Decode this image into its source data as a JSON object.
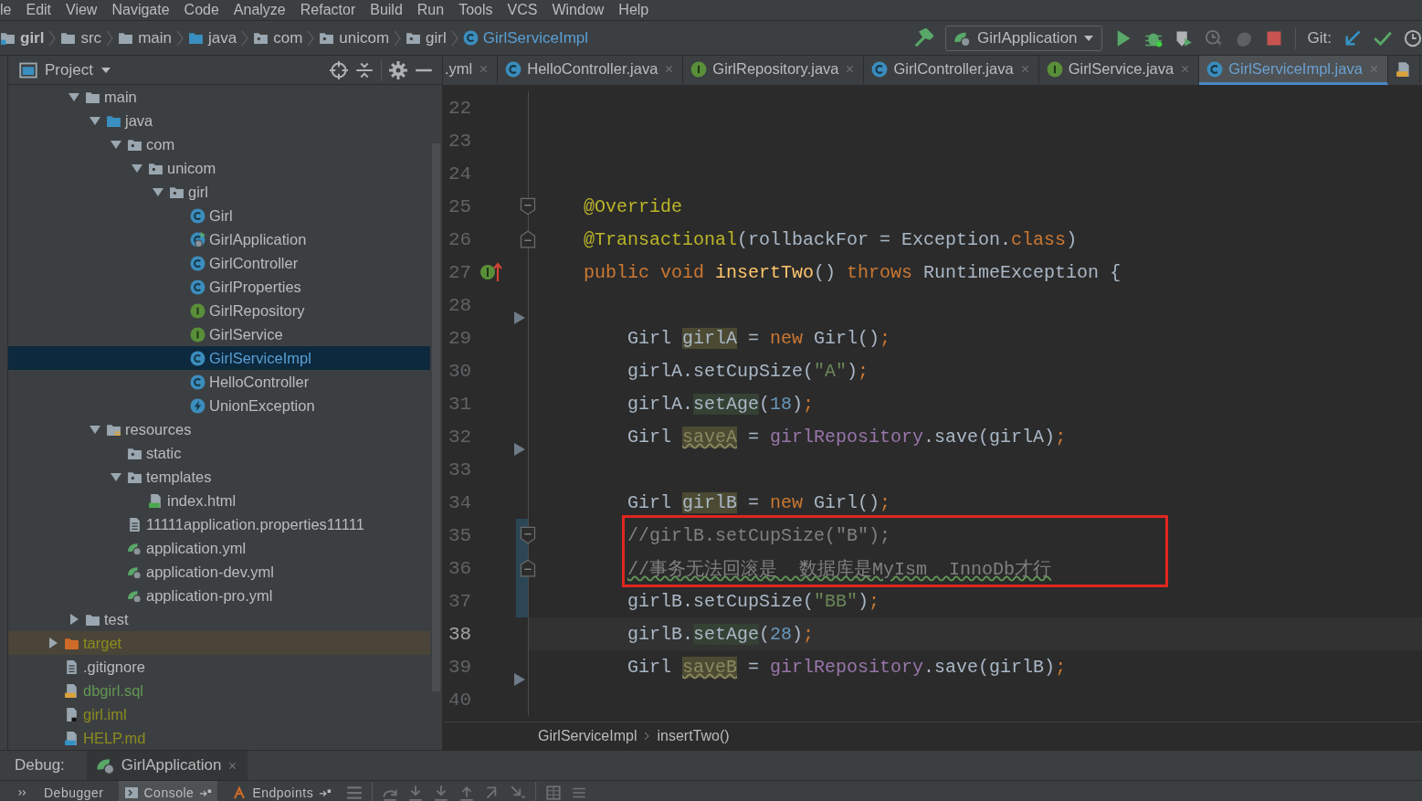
{
  "menu": [
    "le",
    "Edit",
    "View",
    "Navigate",
    "Code",
    "Analyze",
    "Refactor",
    "Build",
    "Run",
    "Tools",
    "VCS",
    "Window",
    "Help"
  ],
  "breadcrumbs": [
    {
      "label": "girl",
      "kind": "module"
    },
    {
      "label": "src",
      "kind": "folder"
    },
    {
      "label": "main",
      "kind": "folder"
    },
    {
      "label": "java",
      "kind": "source-folder"
    },
    {
      "label": "com",
      "kind": "package"
    },
    {
      "label": "unicom",
      "kind": "package"
    },
    {
      "label": "girl",
      "kind": "package"
    },
    {
      "label": "GirlServiceImpl",
      "kind": "class"
    }
  ],
  "run_config": "GirlApplication",
  "vcs_label": "Git:",
  "project_panel": {
    "title": "Project"
  },
  "tree": [
    {
      "children": [
        {
          "label": "main",
          "kind": "folder",
          "expanded": true,
          "selected": false,
          "children": [
            {
              "label": "java",
              "kind": "source-folder",
              "expanded": true,
              "selected": false,
              "children": [
                {
                  "label": "com",
                  "kind": "package",
                  "expanded": true,
                  "selected": false,
                  "children": [
                    {
                      "label": "unicom",
                      "kind": "package",
                      "expanded": true,
                      "selected": false,
                      "children": [
                        {
                          "label": "girl",
                          "kind": "package",
                          "expanded": true,
                          "selected": false,
                          "children": [
                            {
                              "label": "Girl",
                              "kind": "class",
                              "selected": false
                            },
                            {
                              "label": "GirlApplication",
                              "kind": "spring-class",
                              "selected": false
                            },
                            {
                              "label": "GirlController",
                              "kind": "class",
                              "selected": false
                            },
                            {
                              "label": "GirlProperties",
                              "kind": "class",
                              "selected": false
                            },
                            {
                              "label": "GirlRepository",
                              "kind": "interface",
                              "selected": false
                            },
                            {
                              "label": "GirlService",
                              "kind": "interface",
                              "selected": false
                            },
                            {
                              "label": "GirlServiceImpl",
                              "kind": "class",
                              "selected": true
                            },
                            {
                              "label": "HelloController",
                              "kind": "class",
                              "selected": false
                            },
                            {
                              "label": "UnionException",
                              "kind": "exception",
                              "selected": false
                            }
                          ]
                        }
                      ]
                    }
                  ]
                }
              ]
            },
            {
              "label": "resources",
              "kind": "resources",
              "expanded": true,
              "selected": false,
              "children": [
                {
                  "label": "static",
                  "kind": "package",
                  "selected": false
                },
                {
                  "label": "templates",
                  "kind": "package",
                  "expanded": true,
                  "selected": false,
                  "children": [
                    {
                      "label": "index.html",
                      "kind": "html",
                      "selected": false
                    }
                  ]
                },
                {
                  "label": "11111application.properties11111",
                  "kind": "text",
                  "selected": false
                },
                {
                  "label": "application.yml",
                  "kind": "yml",
                  "selected": false
                },
                {
                  "label": "application-dev.yml",
                  "kind": "yml",
                  "selected": false
                },
                {
                  "label": "application-pro.yml",
                  "kind": "yml",
                  "selected": false
                }
              ]
            }
          ]
        },
        {
          "label": "test",
          "kind": "folder",
          "expanded": false,
          "selected": false
        }
      ]
    },
    {
      "label": "target",
      "kind": "excluded-folder",
      "expanded": false,
      "selected": false,
      "color": "#8c8c1e"
    },
    {
      "label": ".gitignore",
      "kind": "text",
      "selected": false
    },
    {
      "label": "dbgirl.sql",
      "kind": "sql",
      "selected": false,
      "color": "#629755"
    },
    {
      "label": "girl.iml",
      "kind": "iml",
      "selected": false,
      "color": "#8c8c1e"
    },
    {
      "label": "HELP.md",
      "kind": "md",
      "selected": false,
      "color": "#8c8c1e"
    }
  ],
  "tabs": [
    {
      "label": ".yml",
      "kind": "plain",
      "selected": false
    },
    {
      "label": "HelloController.java",
      "kind": "class",
      "selected": false
    },
    {
      "label": "GirlRepository.java",
      "kind": "interface",
      "selected": false
    },
    {
      "label": "GirlController.java",
      "kind": "class",
      "selected": false
    },
    {
      "label": "GirlService.java",
      "kind": "interface",
      "selected": false
    },
    {
      "label": "GirlServiceImpl.java",
      "kind": "class",
      "selected": true
    },
    {
      "kind": "sql",
      "selected": false
    }
  ],
  "editor": {
    "lines": [
      {
        "number": "22",
        "kind": "plain",
        "changed": false,
        "current": false,
        "boxed": false
      },
      {
        "number": "23",
        "kind": "plain",
        "changed": false,
        "current": false,
        "boxed": false
      },
      {
        "number": "24",
        "kind": "plain",
        "changed": false,
        "current": false,
        "boxed": false
      },
      {
        "number": "25",
        "kind": "fold-start",
        "changed": false,
        "current": false,
        "boxed": false,
        "tokens": [
          {
            "text": "    @Override",
            "kind": "annotation"
          }
        ]
      },
      {
        "number": "26",
        "kind": "fold-end",
        "changed": false,
        "current": false,
        "boxed": false,
        "tokens": [
          {
            "text": "    @Transactional",
            "kind": "annotation"
          },
          {
            "text": "(rollbackFor = Exception.",
            "kind": "plain"
          },
          {
            "text": "class",
            "kind": "keyword"
          },
          {
            "text": ")",
            "kind": "plain"
          }
        ]
      },
      {
        "number": "27",
        "kind": "implements",
        "changed": false,
        "current": false,
        "boxed": false,
        "tokens": [
          {
            "text": "    public void ",
            "kind": "keyword"
          },
          {
            "text": "insertTwo",
            "kind": "method"
          },
          {
            "text": "() ",
            "kind": "plain"
          },
          {
            "text": "throws ",
            "kind": "keyword"
          },
          {
            "text": "RuntimeException {",
            "kind": "plain"
          }
        ]
      },
      {
        "number": "28",
        "kind": "marker",
        "changed": false,
        "current": false,
        "boxed": false
      },
      {
        "number": "29",
        "kind": "plain",
        "changed": false,
        "current": false,
        "boxed": false,
        "tokens": [
          {
            "text": "        Girl ",
            "kind": "plain"
          },
          {
            "text": "girlA",
            "kind": "var"
          },
          {
            "text": " = ",
            "kind": "plain"
          },
          {
            "text": "new ",
            "kind": "keyword"
          },
          {
            "text": "Girl()",
            "kind": "plain"
          },
          {
            "text": ";",
            "kind": "keyword"
          }
        ]
      },
      {
        "number": "30",
        "kind": "plain",
        "changed": false,
        "current": false,
        "boxed": false,
        "tokens": [
          {
            "text": "        girlA.setCupSize(",
            "kind": "plain"
          },
          {
            "text": "\"A\"",
            "kind": "string"
          },
          {
            "text": ")",
            "kind": "plain"
          },
          {
            "text": ";",
            "kind": "keyword"
          }
        ]
      },
      {
        "number": "31",
        "kind": "plain",
        "changed": false,
        "current": false,
        "boxed": false,
        "tokens": [
          {
            "text": "        girlA.",
            "kind": "plain"
          },
          {
            "text": "setAge",
            "kind": "call"
          },
          {
            "text": "(",
            "kind": "plain"
          },
          {
            "text": "18",
            "kind": "number"
          },
          {
            "text": ")",
            "kind": "plain"
          },
          {
            "text": ";",
            "kind": "keyword"
          }
        ]
      },
      {
        "number": "32",
        "kind": "marker",
        "changed": false,
        "current": false,
        "boxed": false,
        "tokens": [
          {
            "text": "        Girl ",
            "kind": "plain"
          },
          {
            "text": "saveA",
            "kind": "unused"
          },
          {
            "text": " = ",
            "kind": "plain"
          },
          {
            "text": "girlRepository",
            "kind": "field"
          },
          {
            "text": ".save(girlA)",
            "kind": "plain"
          },
          {
            "text": ";",
            "kind": "keyword"
          }
        ]
      },
      {
        "number": "33",
        "kind": "plain",
        "changed": false,
        "current": false,
        "boxed": false
      },
      {
        "number": "34",
        "kind": "plain",
        "changed": false,
        "current": false,
        "boxed": false,
        "tokens": [
          {
            "text": "        Girl ",
            "kind": "plain"
          },
          {
            "text": "girlB",
            "kind": "var"
          },
          {
            "text": " = ",
            "kind": "plain"
          },
          {
            "text": "new ",
            "kind": "keyword"
          },
          {
            "text": "Girl()",
            "kind": "plain"
          },
          {
            "text": ";",
            "kind": "keyword"
          }
        ]
      },
      {
        "number": "35",
        "kind": "fold-start",
        "changed": true,
        "current": false,
        "boxed": true,
        "tokens": [
          {
            "text": "        //girlB.setCupSize(\"B\");",
            "kind": "comment"
          }
        ]
      },
      {
        "number": "36",
        "kind": "fold-end",
        "changed": true,
        "current": false,
        "boxed": true,
        "tokens": [
          {
            "text": "        //事务无法回滚是  数据库是MyIsm  InnoDb才行",
            "kind": "typo"
          }
        ]
      },
      {
        "number": "37",
        "kind": "plain",
        "changed": true,
        "current": false,
        "boxed": false,
        "tokens": [
          {
            "text": "        girlB.setCupSize(",
            "kind": "plain"
          },
          {
            "text": "\"BB\"",
            "kind": "string"
          },
          {
            "text": ")",
            "kind": "plain"
          },
          {
            "text": ";",
            "kind": "keyword"
          }
        ]
      },
      {
        "number": "38",
        "kind": "plain",
        "changed": false,
        "current": true,
        "boxed": false,
        "tokens": [
          {
            "text": "        girlB.",
            "kind": "plain"
          },
          {
            "text": "setAge",
            "kind": "call"
          },
          {
            "text": "(",
            "kind": "plain"
          },
          {
            "text": "28",
            "kind": "number"
          },
          {
            "text": ")",
            "kind": "plain"
          },
          {
            "text": ";",
            "kind": "keyword"
          }
        ]
      },
      {
        "number": "39",
        "kind": "marker",
        "changed": false,
        "current": false,
        "boxed": false,
        "tokens": [
          {
            "text": "        Girl ",
            "kind": "plain"
          },
          {
            "text": "saveB",
            "kind": "unused"
          },
          {
            "text": " = ",
            "kind": "plain"
          },
          {
            "text": "girlRepository",
            "kind": "field"
          },
          {
            "text": ".save(girlB)",
            "kind": "plain"
          },
          {
            "text": ";",
            "kind": "keyword"
          }
        ]
      },
      {
        "number": "40",
        "kind": "plain",
        "changed": false,
        "current": false,
        "boxed": false
      }
    ],
    "breadcrumbs": [
      "GirlServiceImpl",
      "insertTwo()"
    ]
  },
  "debug": {
    "label": "Debug:",
    "session": "GirlApplication",
    "tabs": [
      {
        "label": "Debugger",
        "kind": "plain",
        "selected": false
      },
      {
        "label": "Console",
        "kind": "console",
        "selected": true
      },
      {
        "label": "Endpoints",
        "kind": "endpoints",
        "selected": false
      }
    ]
  }
}
